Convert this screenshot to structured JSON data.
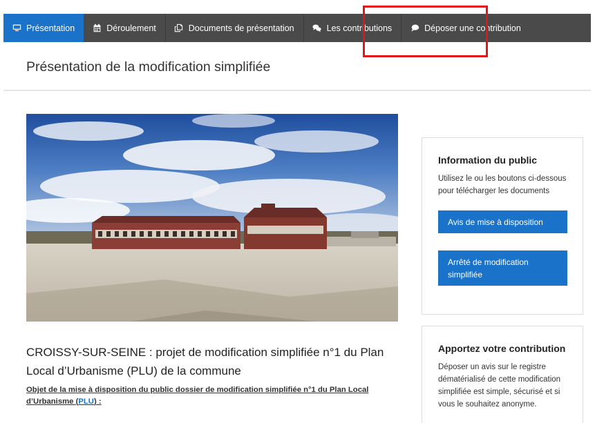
{
  "nav": {
    "items": [
      {
        "label": "Présentation",
        "icon": "monitor-icon",
        "active": true
      },
      {
        "label": "Déroulement",
        "icon": "calendar-icon",
        "active": false
      },
      {
        "label": "Documents de présentation",
        "icon": "documents-icon",
        "active": false
      },
      {
        "label": "Les contributions",
        "icon": "chat-bubbles-icon",
        "active": false
      },
      {
        "label": "Déposer une contribution",
        "icon": "speech-bubble-icon",
        "active": false
      }
    ]
  },
  "page": {
    "title": "Présentation de la modification simplifiée"
  },
  "main": {
    "heading": "CROISSY-SUR-SEINE : projet de modification simplifiée n°1 du Plan Local d’Urbanisme (PLU) de la commune",
    "subject_prefix": "Objet de la mise à disposition du public dossier de modification simplifiée n°1 du Plan Local d’Urbanisme (",
    "subject_link": "PLU",
    "subject_suffix": ") :"
  },
  "sidebar": {
    "info": {
      "title": "Information du public",
      "text": "Utilisez le ou les boutons ci-dessous pour télécharger les documents",
      "buttons": [
        "Avis de mise à disposition",
        "Arrêté de modification simplifiée"
      ]
    },
    "contribute": {
      "title": "Apportez votre contribution",
      "text": "Déposer un avis sur le registre dématérialisé de cette modification simplifiée est simple, sécurisé et si vous le souhaitez anonyme."
    }
  },
  "colors": {
    "nav_bg": "#4a4a4a",
    "nav_active": "#1a73c8",
    "button": "#1a73c8",
    "highlight": "#e0161b"
  }
}
